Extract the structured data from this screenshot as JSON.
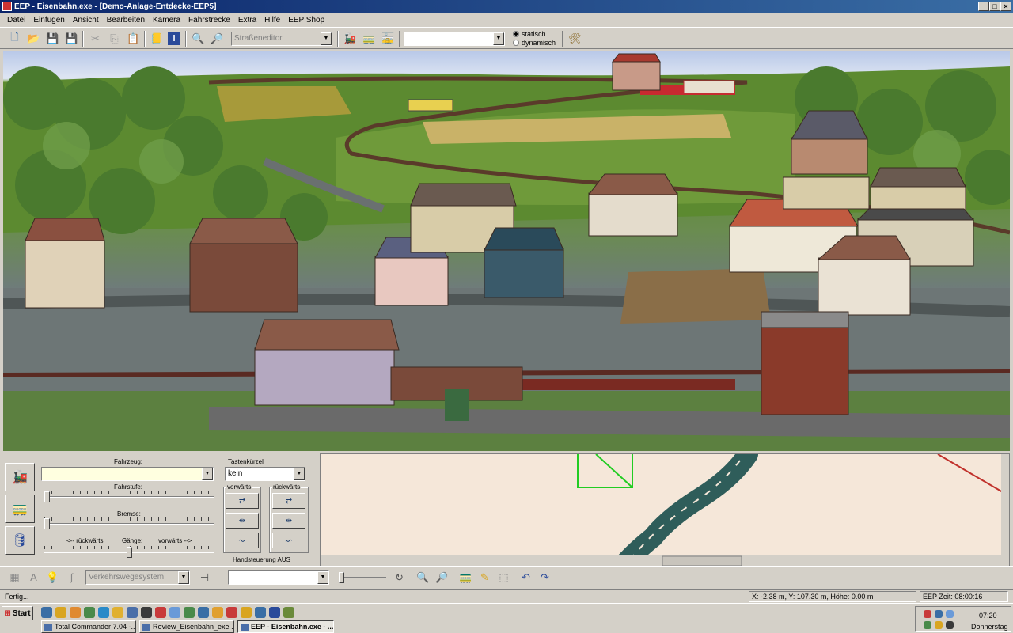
{
  "window": {
    "title": "EEP - Eisenbahn.exe - [Demo-Anlage-Entdecke-EEP5]",
    "controls": [
      "_",
      "□",
      "×"
    ]
  },
  "menu": [
    "Datei",
    "Einfügen",
    "Ansicht",
    "Bearbeiten",
    "Kamera",
    "Fahrstrecke",
    "Extra",
    "Hilfe",
    "EEP Shop"
  ],
  "toolbar": {
    "editor_select": "Straßeneditor",
    "object_combo": "",
    "radio_static": "statisch",
    "radio_dynamic": "dynamisch",
    "radio_selected": "statisch"
  },
  "control_panel": {
    "vehicle_label": "Fahrzeug:",
    "vehicle_value": "",
    "shortcut_label": "Tastenkürzel",
    "shortcut_value": "kein",
    "speed_label": "Fahrstufe:",
    "brake_label": "Bremse:",
    "gear_backward": "<-- rückwärts",
    "gear_label": "Gänge:",
    "gear_forward": "vorwärts -->",
    "forward_label": "vorwärts",
    "backward_label": "rückwärts",
    "manual_control": "Handsteuerung AUS",
    "speed_level": 0,
    "brake_level": 0,
    "gear_position": 0.5
  },
  "bottom_toolbar": {
    "track_system_select": "Verkehrswegesystem",
    "object_combo": ""
  },
  "status": {
    "left": "Fertig...",
    "coords": "X: -2.38 m, Y: 107.30 m, Höhe: 0.00 m",
    "eep_time": "EEP Zeit: 08:00:16"
  },
  "taskbar": {
    "start": "Start",
    "tasks": [
      "Total Commander 7.04 -...",
      "Review_Eisenbahn_exe ...",
      "EEP - Eisenbahn.exe - ..."
    ],
    "active_task": 2,
    "clock": "07:20",
    "day": "Donnerstag"
  },
  "colors": {
    "title_gradient_start": "#0a246a",
    "title_gradient_end": "#3a6ea5",
    "window_face": "#d4d0c8",
    "map_background": "#f5e7d9",
    "map_track": "#2f5d5a",
    "map_selection": "#22cc22",
    "map_line_red": "#c0302a"
  }
}
